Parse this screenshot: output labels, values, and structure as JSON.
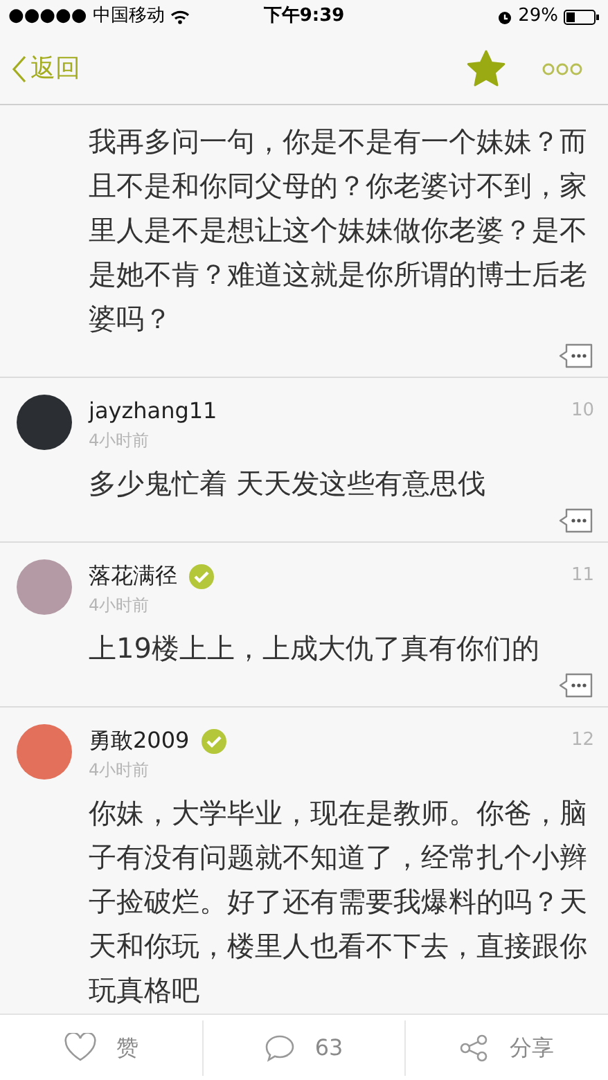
{
  "status_bar": {
    "carrier": "●●●●● 中国移动",
    "time": "下午9:39",
    "battery": "29%"
  },
  "nav": {
    "back": "返回",
    "favorited": true
  },
  "comments": [
    {
      "text": "我再多问一句，你是不是有一个妹妹？而且不是和你同父母的？你老婆讨不到，家里人是不是想让这个妹妹做你老婆？是不是她不肯？难道这就是你所谓的博士后老婆吗？"
    },
    {
      "user": "jayzhang11",
      "verified": false,
      "time": "4小时前",
      "floor": "10",
      "text": "多少鬼忙着 天天发这些有意思伐"
    },
    {
      "user": "落花满径",
      "verified": true,
      "time": "4小时前",
      "floor": "11",
      "text": "上19楼上上，上成大仇了真有你们的"
    },
    {
      "user": "勇敢2009",
      "verified": true,
      "time": "4小时前",
      "floor": "12",
      "text": "你妹，大学毕业，现在是教师。你爸，脑子有没有问题就不知道了，经常扎个小辫子捡破烂。好了还有需要我爆料的吗？天天和你玩，楼里人也看不下去，直接跟你玩真格吧"
    }
  ],
  "bottom_bar": {
    "like": "赞",
    "comments": "63",
    "share": "分享"
  }
}
